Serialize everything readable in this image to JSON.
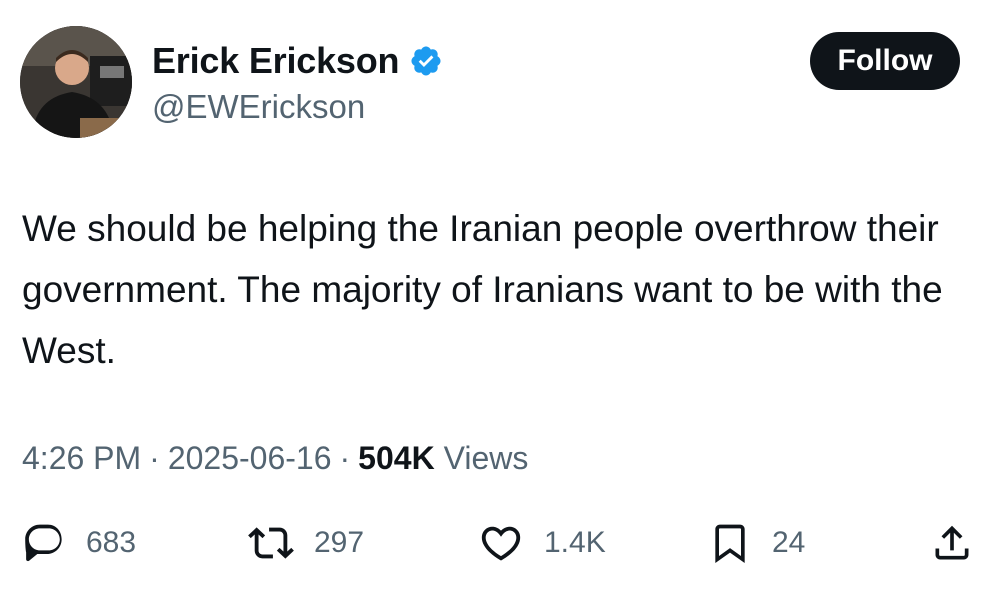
{
  "author": {
    "display_name": "Erick Erickson",
    "handle": "@EWErickson",
    "verified": true
  },
  "follow_button": {
    "label": "Follow"
  },
  "tweet": {
    "text": "We should be helping the Iranian people overthrow their government. The majority of Iranians want to be with the West."
  },
  "meta": {
    "time": "4:26 PM",
    "separator": "·",
    "date": "2025-06-16",
    "views_count": "504K",
    "views_label": "Views"
  },
  "actions": {
    "replies": "683",
    "reposts": "297",
    "likes": "1.4K",
    "bookmarks": "24"
  },
  "colors": {
    "text_primary": "#0f1419",
    "text_secondary": "#536471",
    "verified_blue": "#1d9bf0",
    "button_bg": "#0f1419"
  },
  "icons": [
    "verified-badge-icon",
    "reply-icon",
    "repost-icon",
    "like-icon",
    "bookmark-icon",
    "share-icon"
  ]
}
